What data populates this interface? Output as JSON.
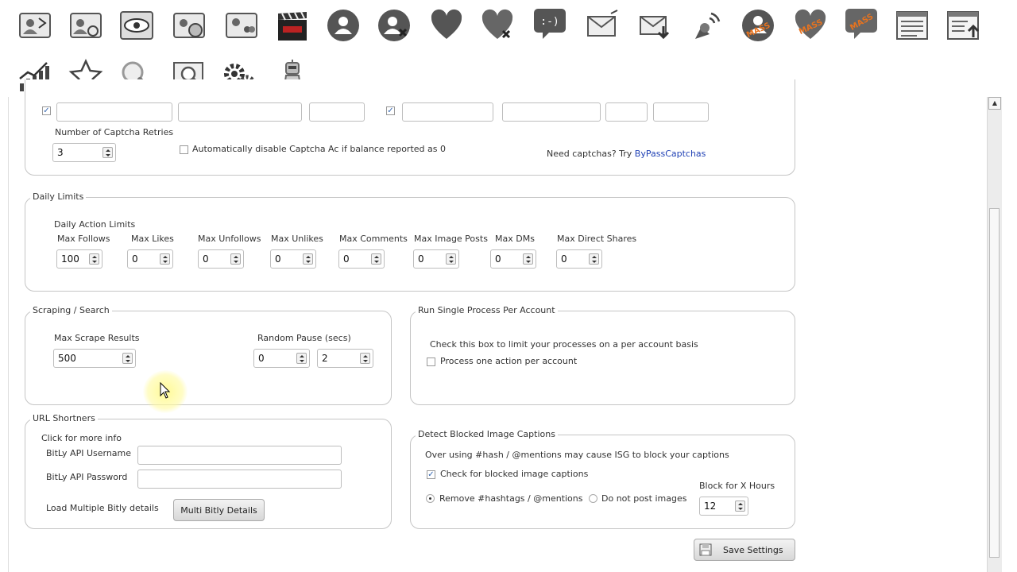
{
  "captcha": {
    "retries_label": "Number of Captcha Retries",
    "retries_value": "3",
    "auto_disable_label": "Automatically disable Captcha Ac if balance reported as 0",
    "need_label": "Need captchas? Try",
    "need_link": "ByPassCaptchas"
  },
  "daily_limits": {
    "legend": "Daily Limits",
    "subtitle": "Daily Action Limits",
    "fields": [
      {
        "label": "Max Follows",
        "value": "100"
      },
      {
        "label": "Max Likes",
        "value": "0"
      },
      {
        "label": "Max Unfollows",
        "value": "0"
      },
      {
        "label": "Max Unlikes",
        "value": "0"
      },
      {
        "label": "Max Comments",
        "value": "0"
      },
      {
        "label": "Max Image Posts",
        "value": "0"
      },
      {
        "label": "Max DMs",
        "value": "0"
      },
      {
        "label": "Max Direct Shares",
        "value": "0"
      }
    ]
  },
  "scraping": {
    "legend": "Scraping / Search",
    "max_label": "Max Scrape Results",
    "max_value": "500",
    "pause_label": "Random Pause (secs)",
    "pause_min": "0",
    "pause_max": "2"
  },
  "single_process": {
    "legend": "Run Single Process Per Account",
    "desc": "Check this box to limit your processes on a per account basis",
    "checkbox_label": "Process one action per account"
  },
  "url_shortners": {
    "legend": "URL Shortners",
    "info": "Click for more info",
    "username_label": "BitLy API Username",
    "password_label": "BitLy API Password",
    "multi_label": "Load Multiple Bitly details",
    "multi_button": "Multi Bitly Details"
  },
  "blocked_captions": {
    "legend": "Detect Blocked Image Captions",
    "warning": "Over using #hash / @mentions may cause ISG to block your captions",
    "check_label": "Check for blocked image captions",
    "radio_remove": "Remove #hashtags / @mentions",
    "radio_nopost": "Do not post images",
    "block_label": "Block for X Hours",
    "block_value": "12"
  },
  "save_button": "Save Settings",
  "toolbar_icons": [
    "user-photo-icon",
    "user-photo-2-icon",
    "view-eye-icon",
    "user-globe-icon",
    "user-group-icon",
    "clapper-icon",
    "contact-add-icon",
    "contact-remove-icon",
    "heart-icon",
    "heart-remove-icon",
    "smiley-chat-icon",
    "mail-icon",
    "mail-download-icon",
    "satellite-icon",
    "mass-contact-icon",
    "mass-heart-icon",
    "mass-chat-icon",
    "list-icon",
    "list-upload-icon",
    "chart-icon",
    "star-icon",
    "search-icon",
    "image-search-icon",
    "settings-gear-icon",
    "robot-icon"
  ],
  "colors": {
    "link": "#2142b5",
    "mass_orange": "#e8731e"
  }
}
